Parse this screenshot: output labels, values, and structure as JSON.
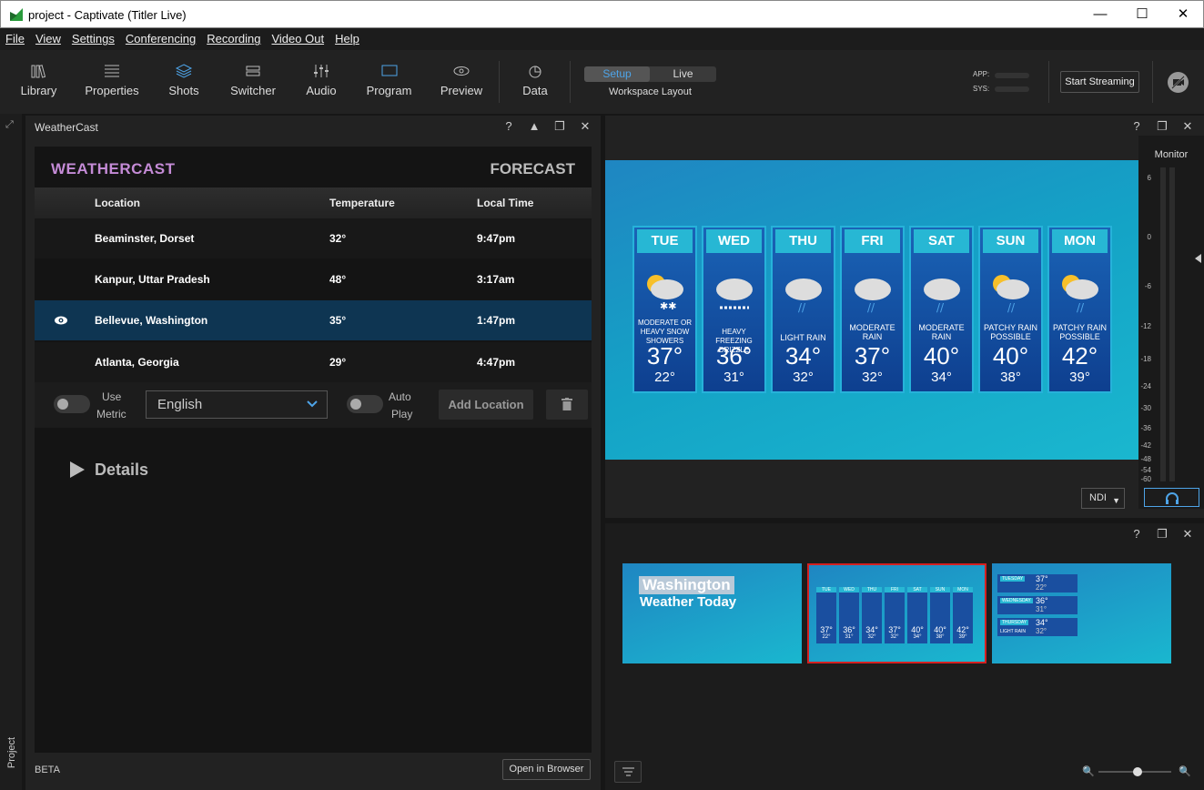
{
  "window": {
    "title": "project - Captivate (Titler Live)"
  },
  "menu": [
    "File",
    "View",
    "Settings",
    "Conferencing",
    "Recording",
    "Video Out",
    "Help"
  ],
  "toolbar": {
    "items": [
      "Library",
      "Properties",
      "Shots",
      "Switcher",
      "Audio",
      "Program",
      "Preview",
      "Data"
    ],
    "setup": "Setup",
    "live": "Live",
    "workspace": "Workspace Layout",
    "app_label": "APP:",
    "sys_label": "SYS:",
    "start_streaming": "Start Streaming"
  },
  "left_strip": {
    "label": "Project"
  },
  "weathercast_panel": {
    "title": "WeatherCast",
    "header_title": "WEATHERCAST",
    "header_right": "FORECAST",
    "columns": [
      "Location",
      "Temperature",
      "Local Time"
    ],
    "rows": [
      {
        "location": "Beaminster, Dorset",
        "temp": "32°",
        "time": "9:47pm"
      },
      {
        "location": "Kanpur, Uttar Pradesh",
        "temp": "48°",
        "time": "3:17am"
      },
      {
        "location": "Bellevue, Washington",
        "temp": "35°",
        "time": "1:47pm"
      },
      {
        "location": "Atlanta, Georgia",
        "temp": "29°",
        "time": "4:47pm"
      }
    ],
    "use_metric_1": "Use",
    "use_metric_2": "Metric",
    "language": "English",
    "auto_play_1": "Auto",
    "auto_play_2": "Play",
    "add_location": "Add Location",
    "details": "Details",
    "beta": "BETA",
    "open_in_browser": "Open in Browser"
  },
  "forecast": [
    {
      "day": "TUE",
      "cond": [
        "MODERATE OR",
        "HEAVY SNOW",
        "SHOWERS"
      ],
      "hi": "37°",
      "lo": "22°"
    },
    {
      "day": "WED",
      "cond": [
        "HEAVY FREEZING",
        "DRIZZLE"
      ],
      "hi": "36°",
      "lo": "31°"
    },
    {
      "day": "THU",
      "cond": [
        "LIGHT RAIN"
      ],
      "hi": "34°",
      "lo": "32°"
    },
    {
      "day": "FRI",
      "cond": [
        "MODERATE",
        "RAIN"
      ],
      "hi": "37°",
      "lo": "32°"
    },
    {
      "day": "SAT",
      "cond": [
        "MODERATE",
        "RAIN"
      ],
      "hi": "40°",
      "lo": "34°"
    },
    {
      "day": "SUN",
      "cond": [
        "PATCHY RAIN",
        "POSSIBLE"
      ],
      "hi": "40°",
      "lo": "38°"
    },
    {
      "day": "MON",
      "cond": [
        "PATCHY RAIN",
        "POSSIBLE"
      ],
      "hi": "42°",
      "lo": "39°"
    }
  ],
  "monitor": {
    "title": "Monitor",
    "scale": [
      "6",
      "0",
      "-6",
      "-12",
      "-18",
      "-24",
      "-30",
      "-36",
      "-42",
      "-48",
      "-54",
      "-60"
    ],
    "output": "NDI"
  },
  "thumbnails": {
    "t1_line1": "Washington",
    "t1_line2": "Weather Today",
    "t2_days": [
      "TUE",
      "WED",
      "THU",
      "FRI",
      "SAT",
      "SUN",
      "MON"
    ],
    "t2_hi": [
      "37°",
      "36°",
      "34°",
      "37°",
      "40°",
      "40°",
      "42°"
    ],
    "t2_lo": [
      "22°",
      "31°",
      "32°",
      "32°",
      "34°",
      "38°",
      "39°"
    ],
    "t3_rows": [
      {
        "day": "TUESDAY",
        "hi": "37°",
        "lo": "22°"
      },
      {
        "day": "WEDNESDAY",
        "hi": "36°",
        "lo": "31°"
      },
      {
        "day": "THURSDAY",
        "hi": "34°",
        "lo": "32°",
        "cond": "LIGHT RAIN"
      }
    ]
  },
  "colors": {
    "accent": "#4ea4e8",
    "selected_row": "#0e3552",
    "selected_thumb_border": "#d42020",
    "weathercast_title": "#c48bd6"
  }
}
